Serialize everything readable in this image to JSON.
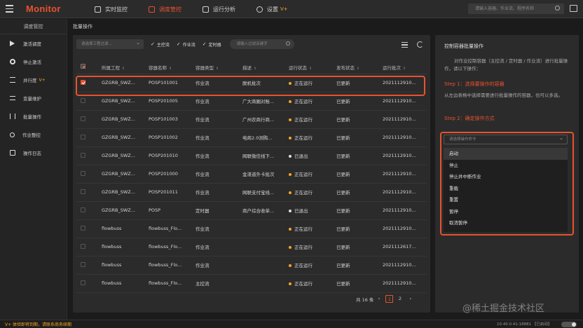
{
  "topbar": {
    "brand": "Monitor",
    "nav": [
      {
        "label": "实时监控",
        "active": false
      },
      {
        "label": "调度管控",
        "active": true
      },
      {
        "label": "运行分析",
        "active": false
      },
      {
        "label": "设置",
        "active": false,
        "badge": "V+"
      }
    ],
    "search_placeholder": "请输入容器、作业流、程序名称"
  },
  "sidebar": {
    "title": "调度管控",
    "items": [
      {
        "label": "激活调度",
        "icon": "play-icon"
      },
      {
        "label": "停止激活",
        "icon": "stop-circle-icon"
      },
      {
        "label": "并行度",
        "icon": "parallel-icon",
        "badge": "V+"
      },
      {
        "label": "变量维护",
        "icon": "sliders-icon"
      },
      {
        "label": "批量操作",
        "icon": "batch-icon"
      },
      {
        "label": "作业整控",
        "icon": "job-control-icon"
      },
      {
        "label": "操作日志",
        "icon": "log-icon"
      }
    ]
  },
  "main": {
    "breadcrumb": "批量操作",
    "filter": {
      "project_placeholder": "请选择工程过滤...",
      "checks": [
        "主控流",
        "作业流",
        "定时器"
      ],
      "keyword_placeholder": "请输入过滤关键字"
    },
    "table": {
      "columns": [
        "所属工程",
        "容器名称",
        "容器类型",
        "描述",
        "运行状态",
        "发布状态",
        "运行批次"
      ],
      "rows": [
        {
          "checked": true,
          "project": "GZGRB_SWZ...",
          "name": "POSP101001",
          "type": "作业流",
          "desc": "脱机批次",
          "status": "正在运行",
          "status_color": "#f5a623",
          "publish": "已更新",
          "batch": "2021112910..."
        },
        {
          "checked": false,
          "project": "GZGRB_SWZ...",
          "name": "POSP201005",
          "type": "作业流",
          "desc": "广大商圈对账...",
          "status": "正在运行",
          "status_color": "#f5a623",
          "publish": "已更新",
          "batch": "2021112910..."
        },
        {
          "checked": false,
          "project": "GZGRB_SWZ...",
          "name": "POSP101003",
          "type": "作业流",
          "desc": "广州农商行商...",
          "status": "正在运行",
          "status_color": "#f5a623",
          "publish": "已更新",
          "batch": "2021112910..."
        },
        {
          "checked": false,
          "project": "GZGRB_SWZ...",
          "name": "POSP101002",
          "type": "作业流",
          "desc": "电商2.0测购...",
          "status": "正在运行",
          "status_color": "#f5a623",
          "publish": "已更新",
          "batch": "2021112910..."
        },
        {
          "checked": false,
          "project": "GZGRB_SWZ...",
          "name": "POSP201010",
          "type": "作业流",
          "desc": "网联微信线下...",
          "status": "已退出",
          "status_color": "#e0e0e0",
          "publish": "已更新",
          "batch": "2021112910..."
        },
        {
          "checked": false,
          "project": "GZGRB_SWZ...",
          "name": "POSP201000",
          "type": "作业流",
          "desc": "金湛道外卡批次",
          "status": "正在运行",
          "status_color": "#f5a623",
          "publish": "已更新",
          "batch": "2021112910..."
        },
        {
          "checked": false,
          "project": "GZGRB_SWZ...",
          "name": "POSP201011",
          "type": "作业流",
          "desc": "网联支付宝线...",
          "status": "正在运行",
          "status_color": "#f5a623",
          "publish": "已更新",
          "batch": "2021112910..."
        },
        {
          "checked": false,
          "project": "GZGRB_SWZ...",
          "name": "POSP",
          "type": "定时器",
          "desc": "商户综合收单...",
          "status": "已退出",
          "status_color": "#e0e0e0",
          "publish": "已更新",
          "batch": "2021112910..."
        },
        {
          "checked": false,
          "project": "flowbuss",
          "name": "flowbuss_Flo...",
          "type": "作业流",
          "desc": "",
          "status": "正在运行",
          "status_color": "#f5a623",
          "publish": "已更新",
          "batch": "2021112910..."
        },
        {
          "checked": false,
          "project": "flowbuss",
          "name": "flowbuss_Flo...",
          "type": "作业流",
          "desc": "",
          "status": "正在运行",
          "status_color": "#f5a623",
          "publish": "已更新",
          "batch": "2021112617..."
        },
        {
          "checked": false,
          "project": "flowbuss",
          "name": "flowbuss_Flo...",
          "type": "作业流",
          "desc": "",
          "status": "正在运行",
          "status_color": "#f5a623",
          "publish": "已更新",
          "batch": "2021112910..."
        },
        {
          "checked": false,
          "project": "flowbuss",
          "name": "flowbuss_Flo...",
          "type": "主控流",
          "desc": "",
          "status": "正在运行",
          "status_color": "#f5a623",
          "publish": "已更新",
          "batch": "2021112910..."
        }
      ]
    },
    "pager": {
      "total": "共 16 条",
      "pages": [
        "1",
        "2"
      ],
      "current": "1"
    }
  },
  "right_panel": {
    "title": "控制容器批量操作",
    "desc": "对作业控制容器（主控流 / 定时器 / 作业流）进行批量操作，请以下操作：",
    "step1_title": "Step 1：选择要操作的容器",
    "step1_text": "从左边表格中选择需要进行批量操作的容器，也可以多选。",
    "step2_title": "Step 2：确定操作方式",
    "op_placeholder": "请选择操作命令",
    "op_options": [
      "启动",
      "停止",
      "停止并中断作业",
      "重载",
      "重置",
      "暂停",
      "取消暂停"
    ]
  },
  "statusbar": {
    "left": "V+ 体验即将到期，请联系商务续期",
    "right": "10.40.0.41:18881 【已启动】"
  },
  "watermark": "@稀土掘金技术社区",
  "colors": {
    "accent": "#e8522f",
    "warning": "#f5a623",
    "background": "#1b1b1b",
    "panel": "#2b2b2b"
  }
}
